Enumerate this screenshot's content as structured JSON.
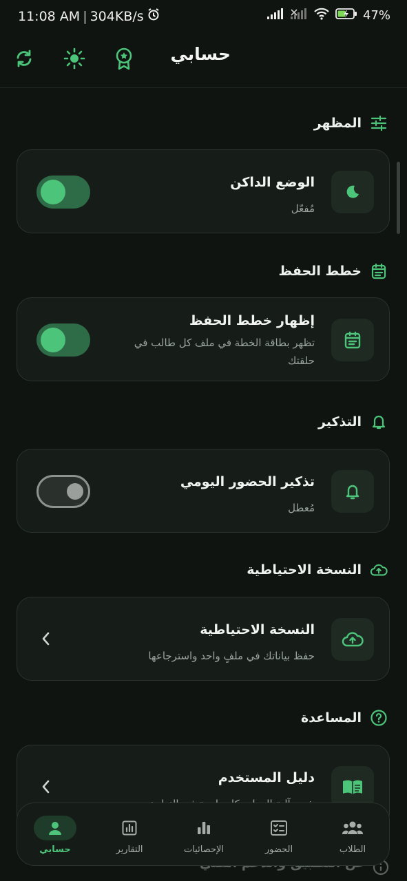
{
  "status_bar": {
    "time": "11:08 AM",
    "speed": "304KB/s",
    "battery": "47%"
  },
  "header": {
    "title": "حسابي"
  },
  "sections": {
    "appearance": {
      "title": "المظهر",
      "dark_mode": {
        "title": "الوضع الداكن",
        "subtitle": "مُفعّل",
        "enabled": true
      }
    },
    "memorization": {
      "title": "خطط الحفظ",
      "show_plans": {
        "title": "إظهار خطط الحفظ",
        "subtitle": "تظهر بطاقة الخطة في ملف كل طالب في حلقتك",
        "enabled": true
      }
    },
    "reminder": {
      "title": "التذكير",
      "daily_attendance": {
        "title": "تذكير الحضور اليومي",
        "subtitle": "مُعطل",
        "enabled": false
      }
    },
    "backup": {
      "title": "النسخة الاحتياطية",
      "backup_item": {
        "title": "النسخة الاحتياطية",
        "subtitle": "حفظ بياناتك في ملفٍ واحد واسترجاعها"
      }
    },
    "help": {
      "title": "المساعدة",
      "user_guide": {
        "title": "دليل المستخدم",
        "subtitle": "شرح آلية العمل وكل واجهة في التطبيق"
      }
    },
    "about_peek": "عن التطبيق والدعم الفني"
  },
  "bottom_nav": {
    "items": [
      {
        "label": "حسابي",
        "active": true
      },
      {
        "label": "التقارير",
        "active": false
      },
      {
        "label": "الإحصائيات",
        "active": false
      },
      {
        "label": "الحضور",
        "active": false
      },
      {
        "label": "الطلاب",
        "active": false
      }
    ]
  },
  "colors": {
    "background": "#0f1411",
    "card": "#161d18",
    "accent": "#4cc47a",
    "icon_bg": "#1f2a23"
  }
}
